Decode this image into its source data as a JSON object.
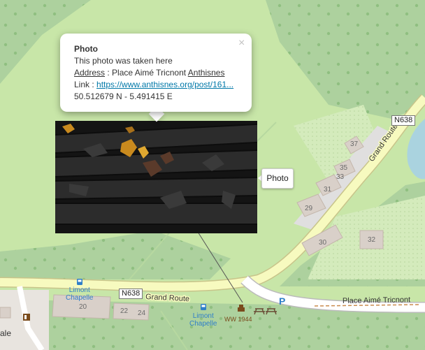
{
  "popup": {
    "title": "Photo",
    "description": "This photo was taken here",
    "address_label": "Address",
    "address_sep": " : Place Aimé Tricnont ",
    "address_link": "Anthisnes",
    "link_label": "Link : ",
    "link_text": "https://www.anthisnes.org/post/161...",
    "coords": "50.512679 N - 5.491415 E",
    "close_symbol": "×"
  },
  "marker_tooltip": "Photo",
  "roads": {
    "n638_top": "N638",
    "grand_route_diag": "Grand Route",
    "n638_bottom": "N638",
    "grand_route_bottom": "Grand Route",
    "place": "Place Aimé Tricnont"
  },
  "house_numbers": [
    "37",
    "35",
    "33",
    "31",
    "29",
    "30",
    "32",
    "20",
    "22",
    "24"
  ],
  "pois": {
    "bus_stop_1": "Limont\nChapelle",
    "bus_stop_2": "Limont\nChapelle",
    "memorial": "WW 1944",
    "parking": "P",
    "edge_label": "ale"
  },
  "colors": {
    "forest": "#add19e",
    "grass": "#cdebb0",
    "road_major": "#f7fabf",
    "water": "#aad3df",
    "building": "#d9d0c9",
    "link": "#0078a8"
  },
  "icons": [
    "close-icon",
    "bus-stop-icon",
    "memorial-icon",
    "picnic-table-icon",
    "parking-icon"
  ]
}
